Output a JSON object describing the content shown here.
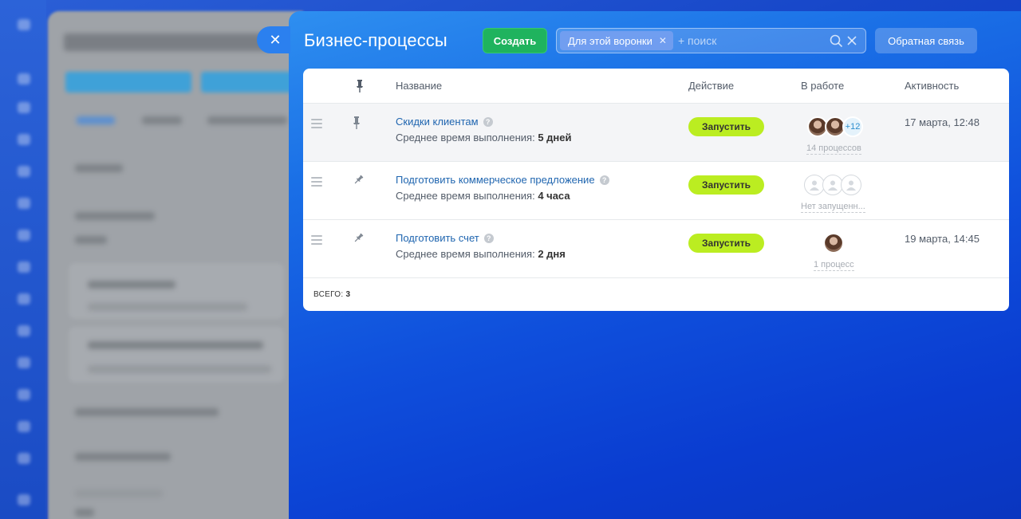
{
  "panel": {
    "title": "Бизнес-процессы",
    "close_glyph": "✕",
    "create_label": "Создать",
    "filter_chip": "Для этой воронки",
    "search_placeholder": "+ поиск",
    "feedback_label": "Обратная связь"
  },
  "grid": {
    "columns": {
      "name": "Название",
      "action": "Действие",
      "in_work": "В работе",
      "activity": "Активность"
    },
    "rows": [
      {
        "name": "Скидки клиентам",
        "avg_label": "Среднее время выполнения:",
        "avg_value": "5 дней",
        "action": "Запустить",
        "more": "+12",
        "processes": "14 процессов",
        "activity": "17 марта, 12:48"
      },
      {
        "name": "Подготовить коммерческое предложение",
        "avg_label": "Среднее время выполнения:",
        "avg_value": "4 часа",
        "action": "Запустить",
        "processes": "Нет запущенн...",
        "activity": ""
      },
      {
        "name": "Подготовить счет",
        "avg_label": "Среднее время выполнения:",
        "avg_value": "2 дня",
        "action": "Запустить",
        "processes": "1 процесс",
        "activity": "19 марта, 14:45"
      }
    ],
    "total_label": "ВСЕГО:",
    "total_value": "3"
  },
  "colors": {
    "create": "#1fb35e",
    "run": "#bbed21",
    "link": "#2066b0"
  },
  "icons": [
    "close-icon",
    "pin-icon",
    "drag-handle-icon",
    "help-icon",
    "search-icon",
    "clear-icon"
  ]
}
